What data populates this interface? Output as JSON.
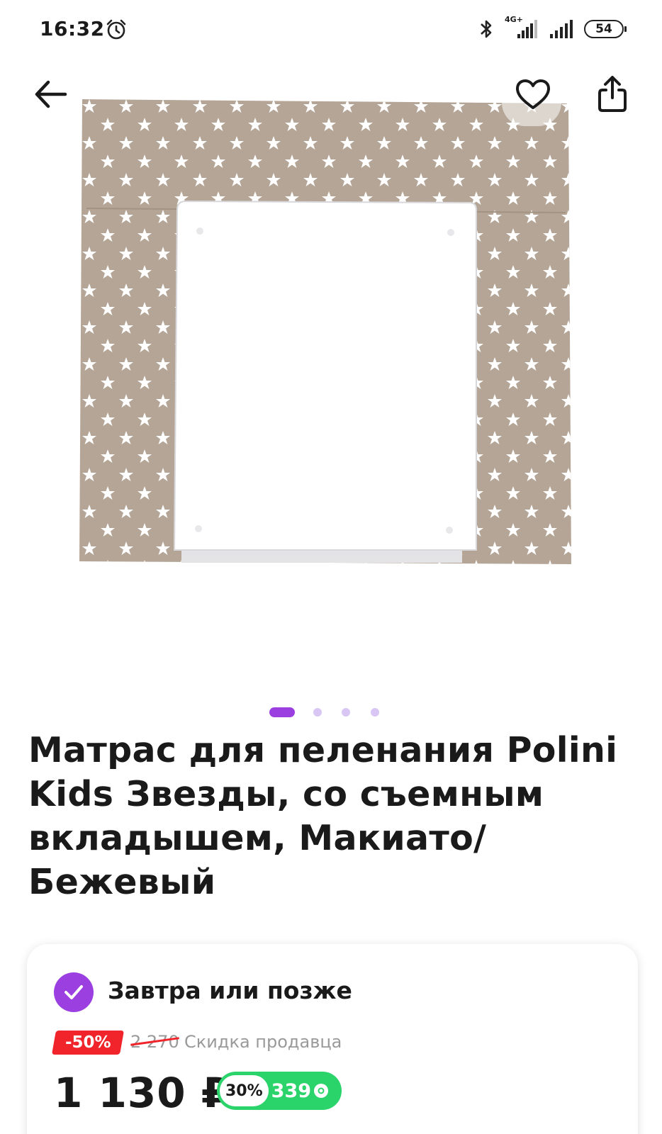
{
  "status_bar": {
    "time": "16:32",
    "network": "4G+",
    "battery": "54"
  },
  "header": {
    "back_icon": "arrow-left-icon",
    "favorite_icon": "heart-icon",
    "share_icon": "share-icon"
  },
  "gallery": {
    "total_images": 4,
    "active_index": 0
  },
  "product": {
    "title": "Матрас для пеленания Polini Kids Звезды, со съемным вкладышем, Макиато/Бежевый"
  },
  "offer": {
    "delivery": "Завтра или позже",
    "discount_badge": "-50%",
    "old_price": "2 270",
    "seller_discount_label": "Скидка продавца",
    "price": "1 130 ₽",
    "bonus_percent": "30%",
    "bonus_amount": "339"
  },
  "colors": {
    "accent": "#9b3fe0",
    "discount_red": "#f0242a",
    "bonus_green": "#2bd36b",
    "mat_beige": "#b4a596"
  }
}
